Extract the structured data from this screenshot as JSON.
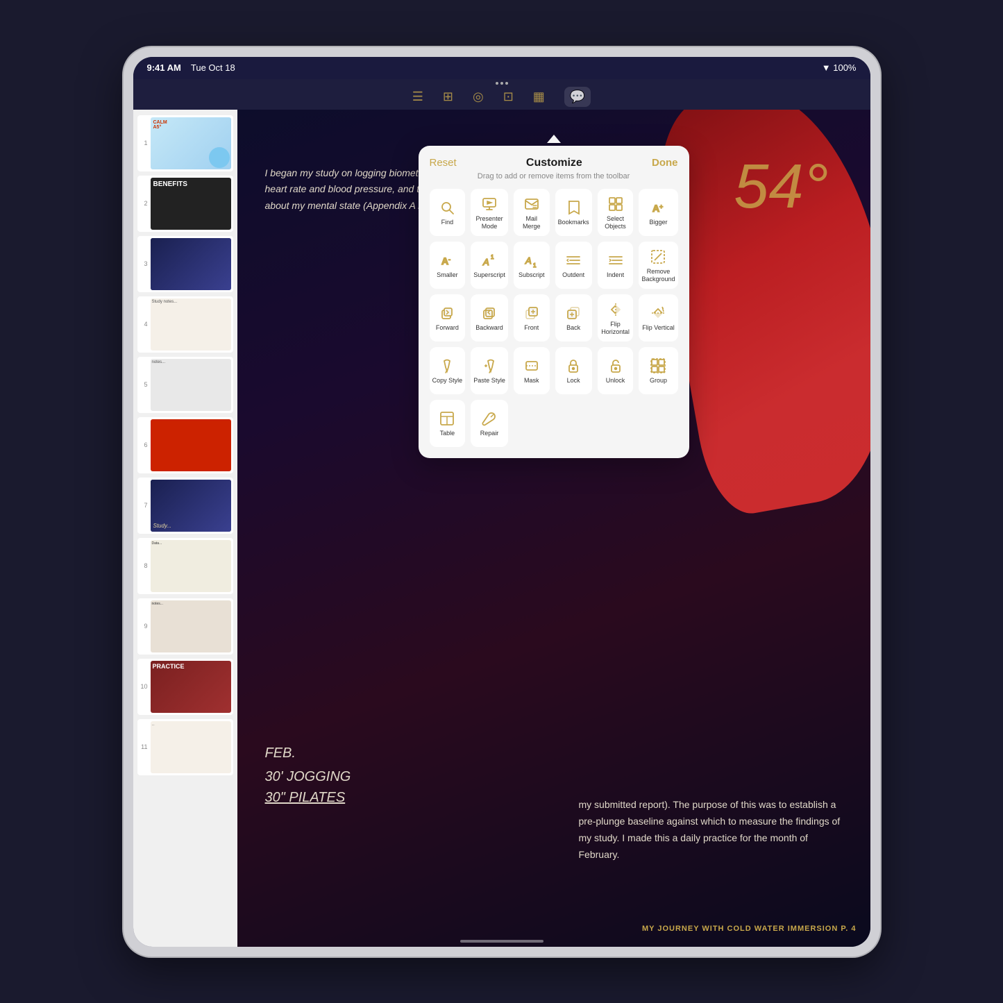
{
  "device": {
    "time": "9:41 AM",
    "date": "Tue Oct 18",
    "battery": "100%",
    "signal": "WiFi"
  },
  "toolbar": {
    "dots_label": "...",
    "icons": [
      "table-icon",
      "shape-icon",
      "media-icon",
      "comment-icon"
    ]
  },
  "sidebar": {
    "slides": [
      {
        "num": "1",
        "type": "preview-1"
      },
      {
        "num": "2",
        "type": "preview-2"
      },
      {
        "num": "3",
        "type": "preview-3"
      },
      {
        "num": "4",
        "type": "preview-4"
      },
      {
        "num": "5",
        "type": "preview-5"
      },
      {
        "num": "6",
        "type": "preview-6"
      },
      {
        "num": "7",
        "type": "preview-7"
      },
      {
        "num": "8",
        "type": "preview-8"
      },
      {
        "num": "9",
        "type": "preview-9"
      },
      {
        "num": "10",
        "type": "preview-10"
      },
      {
        "num": "11",
        "type": "preview-11"
      }
    ]
  },
  "canvas": {
    "big_number": "54°",
    "body_text": "my submitted report). The purpose of this was to establish a pre-plunge baseline against which to measure the findings of my study. I made this a daily practice for the month of February.",
    "handwriting_top": "I began my study on logging biometric data such as resting heart rate and blood pressure, and taking extensive notes about my mental state (Appendix A in",
    "handwriting_bottom": "FEB.\n30' JOGGING\n30\" PILATES",
    "footer": "MY JOURNEY WITH COLD WATER IMMERSION     P. 4"
  },
  "modal": {
    "title": "Customize",
    "reset_label": "Reset",
    "done_label": "Done",
    "subtitle": "Drag to add or remove items from the toolbar",
    "items": [
      {
        "id": "find",
        "label": "Find",
        "icon": "magnifier"
      },
      {
        "id": "presenter-mode",
        "label": "Presenter Mode",
        "icon": "presenter"
      },
      {
        "id": "mail-merge",
        "label": "Mail Merge",
        "icon": "mail-merge"
      },
      {
        "id": "bookmarks",
        "label": "Bookmarks",
        "icon": "bookmark"
      },
      {
        "id": "select-objects",
        "label": "Select Objects",
        "icon": "select"
      },
      {
        "id": "bigger",
        "label": "Bigger",
        "icon": "bigger"
      },
      {
        "id": "smaller",
        "label": "Smaller",
        "icon": "smaller"
      },
      {
        "id": "superscript",
        "label": "Superscript",
        "icon": "superscript"
      },
      {
        "id": "subscript",
        "label": "Subscript",
        "icon": "subscript"
      },
      {
        "id": "outdent",
        "label": "Outdent",
        "icon": "outdent"
      },
      {
        "id": "indent",
        "label": "Indent",
        "icon": "indent"
      },
      {
        "id": "remove-background",
        "label": "Remove Background",
        "icon": "remove-bg"
      },
      {
        "id": "forward",
        "label": "Forward",
        "icon": "forward"
      },
      {
        "id": "backward",
        "label": "Backward",
        "icon": "backward"
      },
      {
        "id": "front",
        "label": "Front",
        "icon": "front"
      },
      {
        "id": "back",
        "label": "Back",
        "icon": "back"
      },
      {
        "id": "flip-horizontal",
        "label": "Flip Horizontal",
        "icon": "flip-h"
      },
      {
        "id": "flip-vertical",
        "label": "Flip Vertical",
        "icon": "flip-v"
      },
      {
        "id": "copy-style",
        "label": "Copy Style",
        "icon": "copy-style"
      },
      {
        "id": "paste-style",
        "label": "Paste Style",
        "icon": "paste-style"
      },
      {
        "id": "mask",
        "label": "Mask",
        "icon": "mask"
      },
      {
        "id": "lock",
        "label": "Lock",
        "icon": "lock"
      },
      {
        "id": "unlock",
        "label": "Unlock",
        "icon": "unlock"
      },
      {
        "id": "group",
        "label": "Group",
        "icon": "group"
      },
      {
        "id": "table",
        "label": "Table",
        "icon": "table-tool"
      },
      {
        "id": "screwdriver",
        "label": "Repair",
        "icon": "screwdriver"
      }
    ]
  }
}
